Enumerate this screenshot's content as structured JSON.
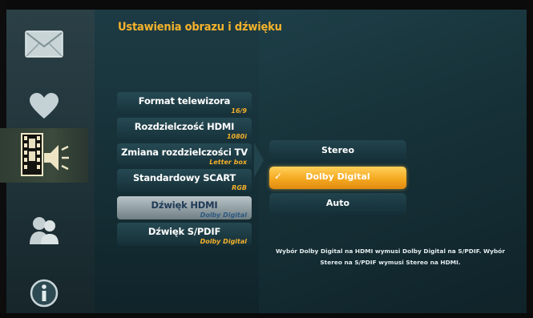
{
  "header": {
    "title": "Ustawienia obrazu i dźwięku"
  },
  "sidebar": {
    "items": [
      {
        "icon": "envelope-icon",
        "selected": false
      },
      {
        "icon": "heart-icon",
        "selected": false
      },
      {
        "icon": "film-speaker-icon",
        "selected": true
      },
      {
        "icon": "users-icon",
        "selected": false
      },
      {
        "icon": "info-icon",
        "selected": false
      }
    ]
  },
  "menu": {
    "items": [
      {
        "label": "Format telewizora",
        "value": "16/9",
        "active": false
      },
      {
        "label": "Rozdzielczość HDMI",
        "value": "1080i",
        "active": false
      },
      {
        "label": "Zmiana rozdzielczości TV",
        "value": "Letter box",
        "active": false
      },
      {
        "label": "Standardowy SCART",
        "value": "RGB",
        "active": false
      },
      {
        "label": "Dźwięk HDMI",
        "value": "Dolby Digital",
        "active": true
      },
      {
        "label": "Dźwięk S/PDIF",
        "value": "Dolby Digital",
        "active": false
      }
    ]
  },
  "options": {
    "items": [
      {
        "label": "Stereo",
        "selected": false
      },
      {
        "label": "Dolby Digital",
        "selected": true
      },
      {
        "label": "Auto",
        "selected": false
      }
    ],
    "check_mark": "✓"
  },
  "description": "Wybór Dolby Digital na HDMI wymusi Dolby Digital na S/PDIF. Wybór Stereo na S/PDIF wymusi Stereo na HDMI.",
  "colors": {
    "accent": "#f5b32b",
    "selected_option": "#f5a820",
    "active_menu": "#a7b3b7"
  }
}
